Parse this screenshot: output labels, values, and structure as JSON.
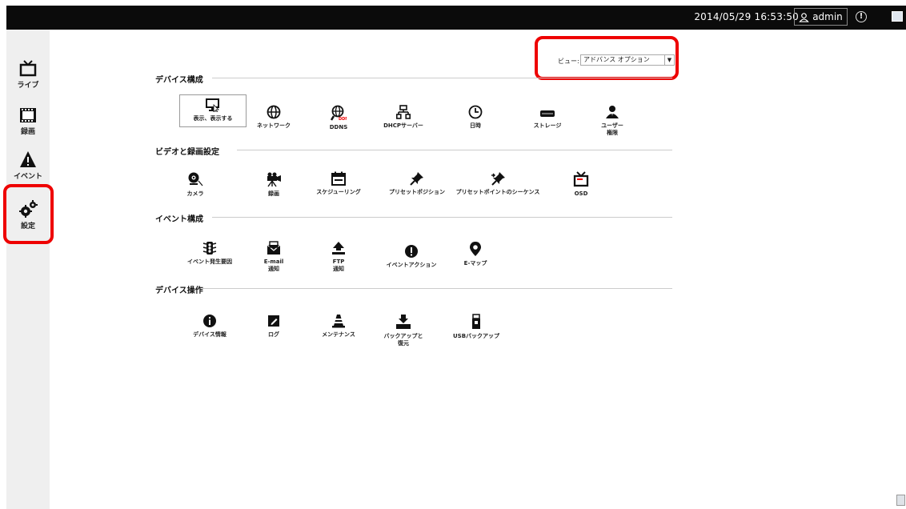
{
  "topbar": {
    "datetime": "2014/05/29 16:53:50",
    "user": "admin"
  },
  "sidebar": [
    {
      "label": "ライブ",
      "icon": "tv-icon"
    },
    {
      "label": "録画",
      "icon": "film-icon"
    },
    {
      "label": "イベント",
      "icon": "warning-icon"
    },
    {
      "label": "設定",
      "icon": "gears-icon"
    }
  ],
  "view": {
    "label": "ビュー:",
    "selected": "アドバンス オプション"
  },
  "sections": {
    "device_config": {
      "title": "デバイス構成",
      "items": [
        {
          "label": "表示、表示する",
          "icon": "monitor-icon"
        },
        {
          "label": "ネットワーク",
          "icon": "globe-icon"
        },
        {
          "label": "DDNS",
          "icon": "ddns-icon"
        },
        {
          "label": "DHCPサーバー",
          "icon": "network-icon"
        },
        {
          "label": "日時",
          "icon": "clock-icon"
        },
        {
          "label": "ストレージ",
          "icon": "hdd-icon"
        },
        {
          "label": "ユーザー\n権限",
          "icon": "users-icon"
        }
      ]
    },
    "video_recording": {
      "title": "ビデオと録画設定",
      "items": [
        {
          "label": "カメラ",
          "icon": "camera-icon"
        },
        {
          "label": "録画",
          "icon": "movie-camera-icon"
        },
        {
          "label": "スケジューリング",
          "icon": "calendar-icon"
        },
        {
          "label": "プリセットポジション",
          "icon": "pin-icon"
        },
        {
          "label": "プリセットポイントのシーケンス",
          "icon": "pin-sequence-icon"
        },
        {
          "label": "OSD",
          "icon": "osd-icon"
        }
      ]
    },
    "event_config": {
      "title": "イベント構成",
      "items": [
        {
          "label": "イベント発生要因",
          "icon": "signal-icon"
        },
        {
          "label": "E-mail\n通知",
          "icon": "mail-icon"
        },
        {
          "label": "FTP\n通知",
          "icon": "upload-icon"
        },
        {
          "label": "イベントアクション",
          "icon": "alert-icon"
        },
        {
          "label": "E-マップ",
          "icon": "map-pin-icon"
        }
      ]
    },
    "device_ops": {
      "title": "デバイス操作",
      "items": [
        {
          "label": "デバイス情報",
          "icon": "info-icon"
        },
        {
          "label": "ログ",
          "icon": "log-icon"
        },
        {
          "label": "メンテナンス",
          "icon": "cone-icon"
        },
        {
          "label": "バックアップと\n復元",
          "icon": "backup-icon"
        },
        {
          "label": "USBバックアップ",
          "icon": "usb-icon"
        }
      ]
    }
  },
  "colors": {
    "highlight": "#e00000",
    "topbar": "#0b0b0b",
    "sidebar": "#efefef"
  }
}
